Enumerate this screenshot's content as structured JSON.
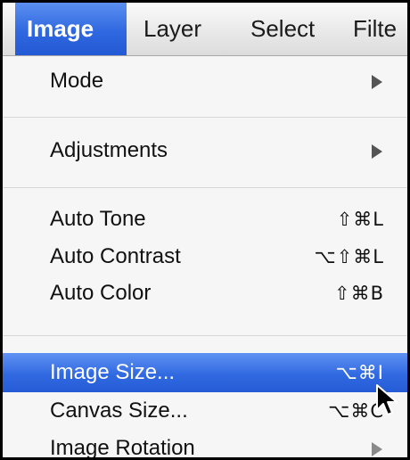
{
  "menubar": {
    "items": [
      {
        "label": "Image"
      },
      {
        "label": "Layer"
      },
      {
        "label": "Select"
      },
      {
        "label": "Filte"
      }
    ]
  },
  "menu": {
    "mode": {
      "label": "Mode"
    },
    "adjustments": {
      "label": "Adjustments"
    },
    "auto_tone": {
      "label": "Auto Tone",
      "shortcut": "⇧⌘L"
    },
    "auto_contrast": {
      "label": "Auto Contrast",
      "shortcut": "⌥⇧⌘L"
    },
    "auto_color": {
      "label": "Auto Color",
      "shortcut": "⇧⌘B"
    },
    "image_size": {
      "label": "Image Size...",
      "shortcut": "⌥⌘I"
    },
    "canvas_size": {
      "label": "Canvas Size...",
      "shortcut": "⌥⌘C"
    },
    "image_rotation": {
      "label": "Image Rotation"
    }
  },
  "colors": {
    "highlight": "#3169e1",
    "menu_background": "#f6f6f6"
  },
  "icons": {
    "submenu": "chevron-right-icon",
    "pointer": "mouse-pointer-icon"
  }
}
